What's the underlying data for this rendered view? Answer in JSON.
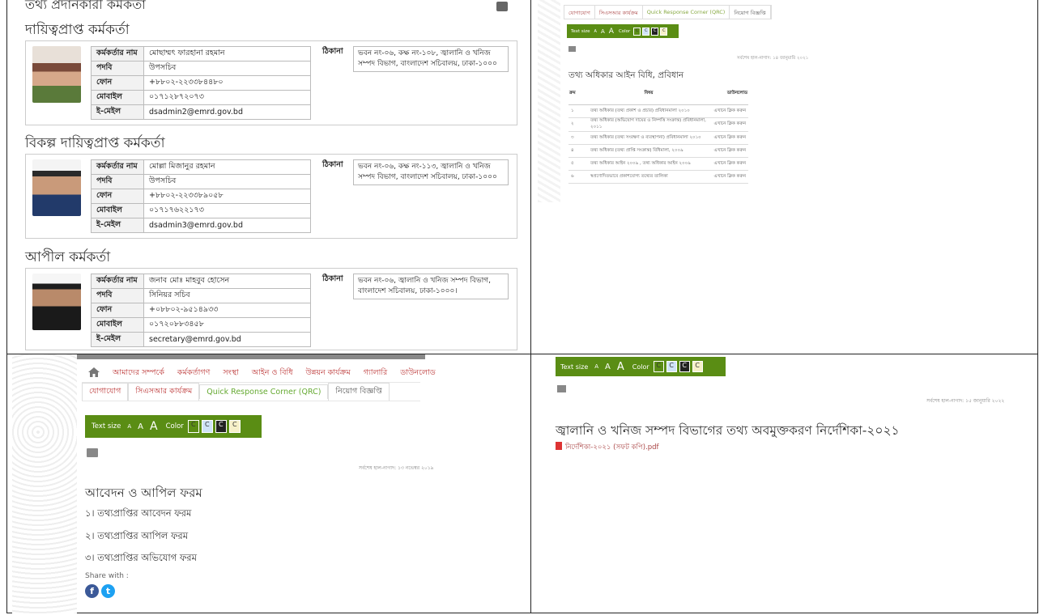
{
  "q1": {
    "page_heading_cut": "তথ্য প্রদানকারী কর্মকর্তা",
    "sections": [
      {
        "title": "দায়িত্বপ্রাপ্ত কর্মকর্তা",
        "fields": [
          {
            "k": "কর্মকর্তার নাম",
            "v": "মোছাম্মৎ ফারহানা রহমান"
          },
          {
            "k": "পদবি",
            "v": "উপসচিব"
          },
          {
            "k": "ফোন",
            "v": "+৮৮০২-২২৩৩৮৪৪৮০"
          },
          {
            "k": "মোবাইল",
            "v": "০১৭১২৮৭২০৭৩"
          },
          {
            "k": "ই-মেইল",
            "v": "dsadmin2@emrd.gov.bd"
          }
        ],
        "addr_label": "ঠিকানা",
        "addr_value": "ভবন নং-০৬, কক্ষ নং-১০৮, জ্বালানি ও খনিজ সম্পদ বিভাগ, বাংলাদেশ সচিবালয়, ঢাকা-১০০০"
      },
      {
        "title": "বিকল্প দায়িত্বপ্রাপ্ত কর্মকর্তা",
        "fields": [
          {
            "k": "কর্মকর্তার নাম",
            "v": "মোল্লা মিজানুর রহমান"
          },
          {
            "k": "পদবি",
            "v": "উপসচিব"
          },
          {
            "k": "ফোন",
            "v": "+৮৮০২-২২৩৩৮৯০৫৮"
          },
          {
            "k": "মোবাইল",
            "v": "০১৭১৭৬২২১৭৩"
          },
          {
            "k": "ই-মেইল",
            "v": "dsadmin3@emrd.gov.bd"
          }
        ],
        "addr_label": "ঠিকানা",
        "addr_value": "ভবন নং-০৬, কক্ষ নং-১১৩, জ্বালানি ও খনিজ সম্পদ বিভাগ, বাংলাদেশ সচিবালয়, ঢাকা-১০০০"
      },
      {
        "title": "আপীল কর্মকর্তা",
        "fields": [
          {
            "k": "কর্মকর্তার নাম",
            "v": "জনাব মোঃ মাহবুব হোসেন"
          },
          {
            "k": "পদবি",
            "v": "সিনিয়র সচিব"
          },
          {
            "k": "ফোন",
            "v": "+০৮৮০২-৯৫১৪৯৩৩"
          },
          {
            "k": "মোবাইল",
            "v": "০১৭২০৮৮৩৪৫৮"
          },
          {
            "k": "ই-মেইল",
            "v": "secretary@emrd.gov.bd"
          }
        ],
        "addr_label": "ঠিকানা",
        "addr_value": "ভবন নং-০৬, জ্বালানি ও খনিজ সম্পদ বিভাগ, বাংলাদেশ সচিবালয়, ঢাকা-১০০০।"
      }
    ]
  },
  "nav": {
    "row1": [
      "আমাদের সম্পর্কে",
      "কর্মকর্তাগণ",
      "সংস্থা",
      "আইন ও বিধি",
      "উন্নয়ন কার্যক্রম",
      "গ্যালারি",
      "ডাউনলোড"
    ],
    "row2": [
      "যোগাযোগ",
      "সিএসআর কার্যক্রম",
      "Quick Response Corner (QRC)",
      "নিয়োগ বিজ্ঞপ্তি"
    ]
  },
  "textsize": {
    "label": "Text size",
    "a_small": "A",
    "a_mid": "A",
    "a_big": "A",
    "color_label": "Color",
    "swatch": "C",
    "swatch_colors": [
      "#ffffff",
      "#cfe3f7",
      "#222222",
      "#f6f0c8"
    ]
  },
  "q2": {
    "tabs": [
      "যোগাযোগ",
      "সিএসআর কার্যক্রম",
      "Quick Response Corner (QRC)",
      "নিয়োগ বিজ্ঞপ্তি"
    ],
    "updated": "সর্বশেষ হাল-নাগাদ: ১৪ জানুয়ারি ২০২১",
    "title": "তথ্য অধিকার আইন বিধি, প্রবিধান",
    "headers": [
      "ক্রম",
      "বিষয়",
      "ডাউনলোড"
    ],
    "rows": [
      {
        "n": "১",
        "s": "তথ্য অধিকার (তথ্য প্রকাশ ও প্রচার) প্রবিধানমালা ২০১০",
        "d": "এখানে ক্লিক করুন"
      },
      {
        "n": "২",
        "s": "তথ্য অধিকার (অভিযোগ দায়ের ও নিষ্পত্তি সংক্রান্ত) প্রবিধানমালা, ২০১১",
        "d": "এখানে ক্লিক করুন"
      },
      {
        "n": "৩",
        "s": "তথ্য অধিকার (তথ্য সংরক্ষণ ও ব্যবস্থাপনা) প্রবিধানমালা ২০১০",
        "d": "এখানে ক্লিক করুন"
      },
      {
        "n": "৪",
        "s": "তথ্য অধিকার (তথ্য প্রাপ্তি সংক্রান্ত) বিধিমালা, ২০০৯",
        "d": "এখানে ক্লিক করুন"
      },
      {
        "n": "৫",
        "s": "তথ্য অধিকার আইন ২০০৯ , তথ্য অধিকার আইন ২০০৯",
        "d": "এখানে ক্লিক করুন"
      },
      {
        "n": "৬",
        "s": "স্বপ্রণোদিতভাবে প্রকাশযোগ্য তথ্যের তালিকা",
        "d": "এখানে ক্লিক করুন"
      }
    ]
  },
  "q3": {
    "updated": "সর্বশেষ হাল-নাগাদ: ১৩ নভেম্বর ২০১৯",
    "title": "আবেদন ও আপিল ফরম",
    "items": [
      "১।  তথ্যপ্রাপ্তির আবেদন ফরম",
      "২।  তথ্যপ্রাপ্তির আপিল ফরম",
      "৩।  তথ্যপ্রাপ্তির অভিযোগ ফরম"
    ],
    "share_label": "Share with :",
    "facebook_glyph": "f",
    "twitter_glyph": "t"
  },
  "q4": {
    "updated": "সর্বশেষ হাল-নাগাদ: ১৫ জানুয়ারি ২০২২",
    "title": "জ্বালানি ও খনিজ সম্পদ বিভাগের তথ্য অবমুক্তকরণ নির্দেশিকা-২০২১",
    "file": "নির্দেশিকা-২০২১ (সফট কপি).pdf"
  }
}
